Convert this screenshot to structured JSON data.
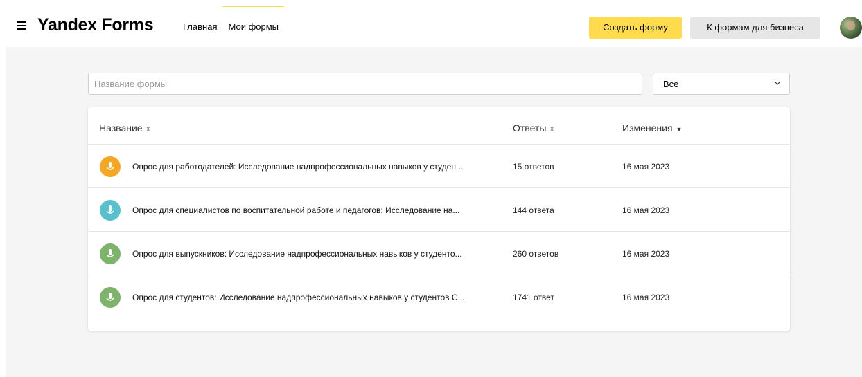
{
  "header": {
    "logo": "Yandex Forms",
    "nav": [
      {
        "label": "Главная",
        "active": false
      },
      {
        "label": "Мои формы",
        "active": true
      }
    ],
    "create_button": "Создать форму",
    "business_button": "К формам для бизнеса",
    "icons": {
      "menu": "hamburger-icon",
      "avatar": "user-avatar"
    }
  },
  "filters": {
    "search_placeholder": "Название формы",
    "search_value": "",
    "select_value": "Все"
  },
  "table": {
    "columns": [
      {
        "label": "Название",
        "sort": "⬍"
      },
      {
        "label": "Ответы",
        "sort": "⬍"
      },
      {
        "label": "Изменения",
        "sort": "▼"
      }
    ],
    "rows": [
      {
        "title": "Опрос для работодателей: Исследование надпрофессиональных навыков у студен...",
        "answers": "15 ответов",
        "date": "16 мая 2023",
        "icon_color": "#f5a623"
      },
      {
        "title": "Опрос для специалистов по воспитательной работе и педагогов: Исследование на...",
        "answers": "144 ответа",
        "date": "16 мая 2023",
        "icon_color": "#56c1cc"
      },
      {
        "title": "Опрос для выпускников: Исследование надпрофессиональных навыков у студенто...",
        "answers": "260 ответов",
        "date": "16 мая 2023",
        "icon_color": "#7db36a"
      },
      {
        "title": "Опрос для студентов: Исследование надпрофессиональных навыков у студентов С...",
        "answers": "1741 ответ",
        "date": "16 мая 2023",
        "icon_color": "#7db36a"
      }
    ]
  },
  "colors": {
    "accent": "#ffdb4d",
    "background": "#f5f5f5"
  }
}
